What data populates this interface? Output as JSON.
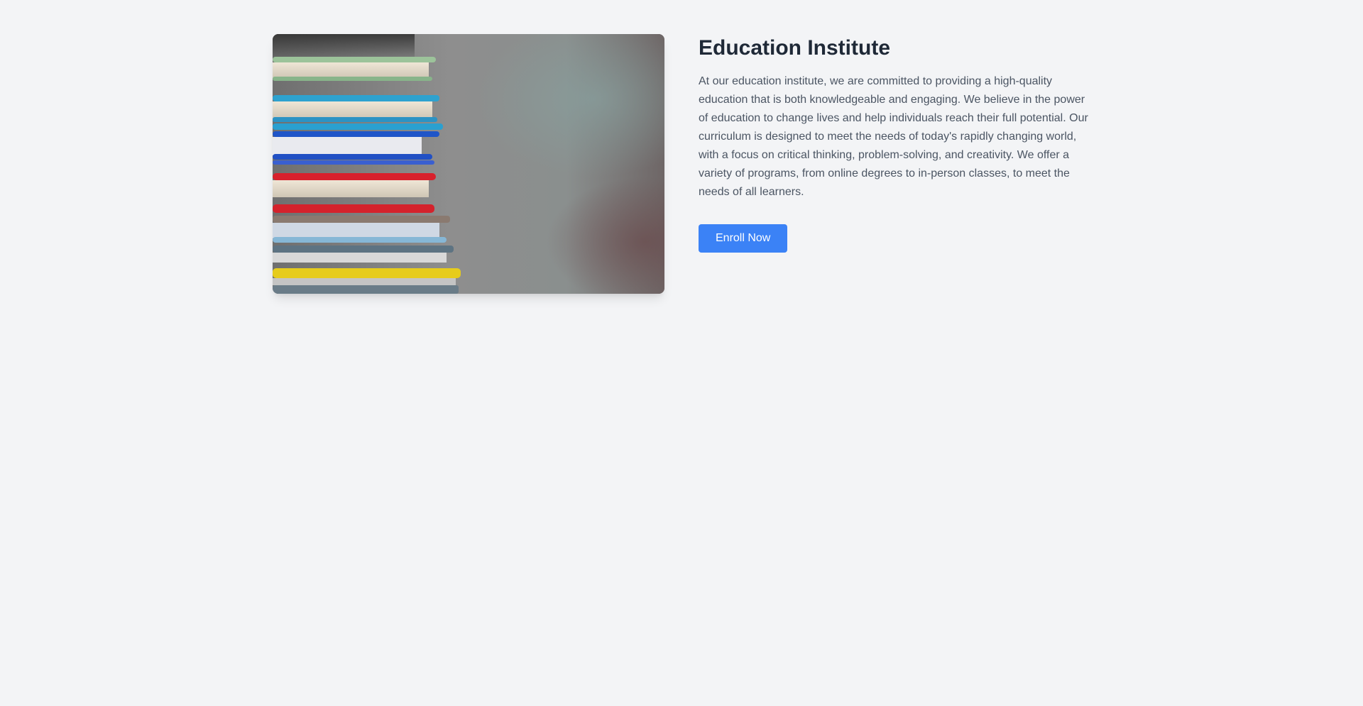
{
  "hero": {
    "image_subject": "stack-of-colorful-books",
    "title": "Education Institute",
    "description": "At our education institute, we are committed to providing a high-quality education that is both knowledgeable and engaging. We believe in the power of education to change lives and help individuals reach their full potential. Our curriculum is designed to meet the needs of today's rapidly changing world, with a focus on critical thinking, problem-solving, and creativity. We offer a variety of programs, from online degrees to in-person classes, to meet the needs of all learners.",
    "cta_label": "Enroll Now"
  },
  "colors": {
    "background": "#f3f4f6",
    "title": "#1f2937",
    "body_text": "#4b5563",
    "accent": "#3b82f6"
  }
}
